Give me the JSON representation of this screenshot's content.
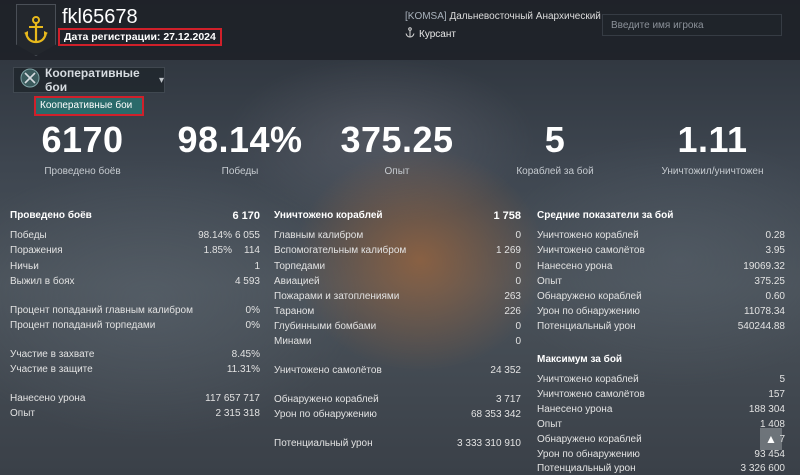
{
  "header": {
    "nickname": "fkl65678",
    "reg_date": "Дата регистрации: 27.12.2024",
    "clan_tag": "[KOMSA]",
    "clan_name": "Дальневосточный Анархический",
    "rank": "Курсант",
    "search_placeholder": "Введите имя игрока",
    "emblem_icon": "anchor-icon",
    "rank_icon": "anchor-icon"
  },
  "mode": {
    "selected": "Кооперативные бои",
    "option": "Кооперативные бои",
    "icon": "co-op-icon"
  },
  "summary": [
    {
      "value": "6170",
      "label": "Проведено боёв"
    },
    {
      "value": "98.14%",
      "label": "Победы"
    },
    {
      "value": "375.25",
      "label": "Опыт"
    },
    {
      "value": "5",
      "label": "Кораблей за бой"
    },
    {
      "value": "1.11",
      "label": "Уничтожил/уничтожен"
    }
  ],
  "col1": {
    "battles": {
      "label": "Проведено боёв",
      "value": "6 170"
    },
    "wins": {
      "label": "Победы",
      "pct": "98.14%",
      "value": "6 055"
    },
    "losses": {
      "label": "Поражения",
      "pct": "1.85%",
      "value": "114"
    },
    "draws": {
      "label": "Ничьи",
      "value": "1"
    },
    "survived": {
      "label": "Выжил в боях",
      "value": "4 593"
    },
    "main_hit": {
      "label": "Процент попаданий главным калибром",
      "value": "0%"
    },
    "torp_hit": {
      "label": "Процент попаданий торпедами",
      "value": "0%"
    },
    "capture": {
      "label": "Участие в захвате",
      "value": "8.45%"
    },
    "defense": {
      "label": "Участие в защите",
      "value": "11.31%"
    },
    "damage": {
      "label": "Нанесено урона",
      "value": "117 657 717"
    },
    "xp": {
      "label": "Опыт",
      "value": "2 315 318"
    }
  },
  "col2": {
    "ships": {
      "label": "Уничтожено кораблей",
      "value": "1 758"
    },
    "main": {
      "label": "Главным калибром",
      "value": "0"
    },
    "secondary": {
      "label": "Вспомогательным калибром",
      "value": "1 269"
    },
    "torpedoes": {
      "label": "Торпедами",
      "value": "0"
    },
    "aircraft": {
      "label": "Авиацией",
      "value": "0"
    },
    "fires": {
      "label": "Пожарами и затоплениями",
      "value": "263"
    },
    "ram": {
      "label": "Тараном",
      "value": "226"
    },
    "depth": {
      "label": "Глубинными бомбами",
      "value": "0"
    },
    "mines": {
      "label": "Минами",
      "value": "0"
    },
    "planes": {
      "label": "Уничтожено самолётов",
      "value": "24 352"
    },
    "spotted": {
      "label": "Обнаружено кораблей",
      "value": "3 717"
    },
    "spot_dmg": {
      "label": "Урон по обнаружению",
      "value": "68 353 342"
    },
    "potential": {
      "label": "Потенциальный урон",
      "value": "3 333 310 910"
    }
  },
  "col3": {
    "avg_title": "Средние показатели за бой",
    "avg": [
      {
        "label": "Уничтожено кораблей",
        "value": "0.28"
      },
      {
        "label": "Уничтожено самолётов",
        "value": "3.95"
      },
      {
        "label": "Нанесено урона",
        "value": "19069.32"
      },
      {
        "label": "Опыт",
        "value": "375.25"
      },
      {
        "label": "Обнаружено кораблей",
        "value": "0.60"
      },
      {
        "label": "Урон по обнаружению",
        "value": "11078.34"
      },
      {
        "label": "Потенциальный урон",
        "value": "540244.88"
      }
    ],
    "max_title": "Максимум за бой",
    "max": [
      {
        "label": "Уничтожено кораблей",
        "value": "5"
      },
      {
        "label": "Уничтожено самолётов",
        "value": "157"
      },
      {
        "label": "Нанесено урона",
        "value": "188 304"
      },
      {
        "label": "Опыт",
        "value": "1 408"
      },
      {
        "label": "Обнаружено кораблей",
        "value": "7"
      },
      {
        "label": "Урон по обнаружению",
        "value": "93 454"
      },
      {
        "label": "Потенциальный урон",
        "value": "3 326 600"
      }
    ]
  },
  "scroll_icon": "arrow-up-icon"
}
